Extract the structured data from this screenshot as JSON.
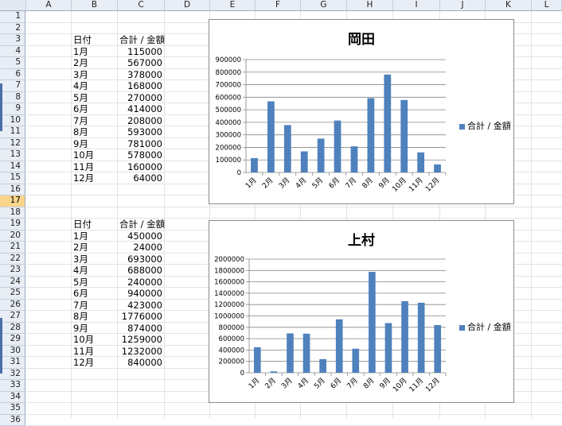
{
  "columns": [
    "A",
    "B",
    "C",
    "D",
    "E",
    "F",
    "G",
    "H",
    "I",
    "J",
    "K",
    "L"
  ],
  "rows": [
    "1",
    "2",
    "3",
    "4",
    "5",
    "6",
    "7",
    "8",
    "9",
    "10",
    "11",
    "12",
    "13",
    "14",
    "15",
    "16",
    "17",
    "18",
    "19",
    "20",
    "21",
    "22",
    "23",
    "24",
    "25",
    "26",
    "27",
    "28",
    "29",
    "30",
    "31",
    "32",
    "33",
    "34",
    "35",
    "36"
  ],
  "selected_row": "17",
  "table_okada": {
    "header_date": "日付",
    "header_sum": "合計 / 金額",
    "rows": [
      {
        "month": "1月",
        "value": "115000"
      },
      {
        "month": "2月",
        "value": "567000"
      },
      {
        "month": "3月",
        "value": "378000"
      },
      {
        "month": "4月",
        "value": "168000"
      },
      {
        "month": "5月",
        "value": "270000"
      },
      {
        "month": "6月",
        "value": "414000"
      },
      {
        "month": "7月",
        "value": "208000"
      },
      {
        "month": "8月",
        "value": "593000"
      },
      {
        "month": "9月",
        "value": "781000"
      },
      {
        "month": "10月",
        "value": "578000"
      },
      {
        "month": "11月",
        "value": "160000"
      },
      {
        "month": "12月",
        "value": "64000"
      }
    ]
  },
  "table_uemura": {
    "header_date": "日付",
    "header_sum": "合計 / 金額",
    "rows": [
      {
        "month": "1月",
        "value": "450000"
      },
      {
        "month": "2月",
        "value": "24000"
      },
      {
        "month": "3月",
        "value": "693000"
      },
      {
        "month": "4月",
        "value": "688000"
      },
      {
        "month": "5月",
        "value": "240000"
      },
      {
        "month": "6月",
        "value": "940000"
      },
      {
        "month": "7月",
        "value": "423000"
      },
      {
        "month": "8月",
        "value": "1776000"
      },
      {
        "month": "9月",
        "value": "874000"
      },
      {
        "month": "10月",
        "value": "1259000"
      },
      {
        "month": "11月",
        "value": "1232000"
      },
      {
        "month": "12月",
        "value": "840000"
      }
    ]
  },
  "chart_data": [
    {
      "type": "bar",
      "title": "岡田",
      "categories": [
        "1月",
        "2月",
        "3月",
        "4月",
        "5月",
        "6月",
        "7月",
        "8月",
        "9月",
        "10月",
        "11月",
        "12月"
      ],
      "series": [
        {
          "name": "合計 / 金額",
          "values": [
            115000,
            567000,
            378000,
            168000,
            270000,
            414000,
            208000,
            593000,
            781000,
            578000,
            160000,
            64000
          ]
        }
      ],
      "ylim": [
        0,
        900000
      ],
      "yticks": [
        "0",
        "100000",
        "200000",
        "300000",
        "400000",
        "500000",
        "600000",
        "700000",
        "800000",
        "900000"
      ],
      "legend_position": "right",
      "grid": true,
      "bar_color": "#4f81bd"
    },
    {
      "type": "bar",
      "title": "上村",
      "categories": [
        "1月",
        "2月",
        "3月",
        "4月",
        "5月",
        "6月",
        "7月",
        "8月",
        "9月",
        "10月",
        "11月",
        "12月"
      ],
      "series": [
        {
          "name": "合計 / 金額",
          "values": [
            450000,
            24000,
            693000,
            688000,
            240000,
            940000,
            423000,
            1776000,
            874000,
            1259000,
            1232000,
            840000
          ]
        }
      ],
      "ylim": [
        0,
        2000000
      ],
      "yticks": [
        "0",
        "200000",
        "400000",
        "600000",
        "800000",
        "1000000",
        "1200000",
        "1400000",
        "1600000",
        "1800000",
        "2000000"
      ],
      "legend_position": "right",
      "grid": true,
      "bar_color": "#4f81bd"
    }
  ]
}
